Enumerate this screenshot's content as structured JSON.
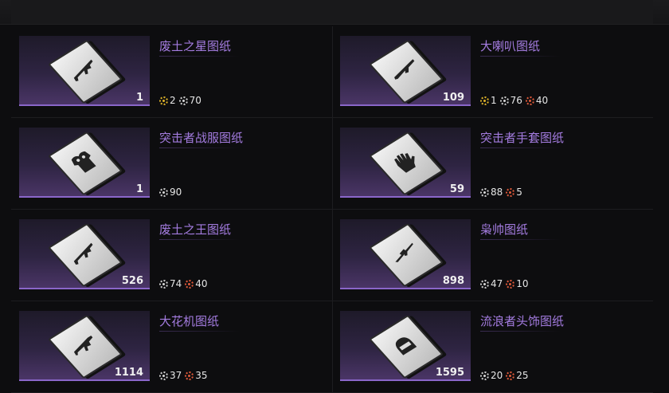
{
  "items": [
    {
      "name": "废土之星图纸",
      "count": "1",
      "icon": "rifle-icon",
      "costs": [
        {
          "type": "gold",
          "value": "2"
        },
        {
          "type": "white",
          "value": "70"
        }
      ]
    },
    {
      "name": "大喇叭图纸",
      "count": "109",
      "icon": "shotgun-icon",
      "costs": [
        {
          "type": "gold",
          "value": "1"
        },
        {
          "type": "white",
          "value": "76"
        },
        {
          "type": "red",
          "value": "40"
        }
      ]
    },
    {
      "name": "突击者战服图纸",
      "count": "1",
      "icon": "armor-icon",
      "costs": [
        {
          "type": "white",
          "value": "90"
        }
      ]
    },
    {
      "name": "突击者手套图纸",
      "count": "59",
      "icon": "glove-icon",
      "costs": [
        {
          "type": "white",
          "value": "88"
        },
        {
          "type": "red",
          "value": "5"
        }
      ]
    },
    {
      "name": "废土之王图纸",
      "count": "526",
      "icon": "rifle-icon",
      "costs": [
        {
          "type": "white",
          "value": "74"
        },
        {
          "type": "red",
          "value": "40"
        }
      ]
    },
    {
      "name": "枭帅图纸",
      "count": "898",
      "icon": "sniper-icon",
      "costs": [
        {
          "type": "white",
          "value": "47"
        },
        {
          "type": "red",
          "value": "10"
        }
      ]
    },
    {
      "name": "大花机图纸",
      "count": "1114",
      "icon": "smg-icon",
      "costs": [
        {
          "type": "white",
          "value": "37"
        },
        {
          "type": "red",
          "value": "35"
        }
      ]
    },
    {
      "name": "流浪者头饰图纸",
      "count": "1595",
      "icon": "helmet-icon",
      "costs": [
        {
          "type": "white",
          "value": "20"
        },
        {
          "type": "red",
          "value": "25"
        }
      ]
    }
  ],
  "colors": {
    "accent": "#a47ce0",
    "gold": "#e0b42a",
    "red": "#e05a3a"
  }
}
